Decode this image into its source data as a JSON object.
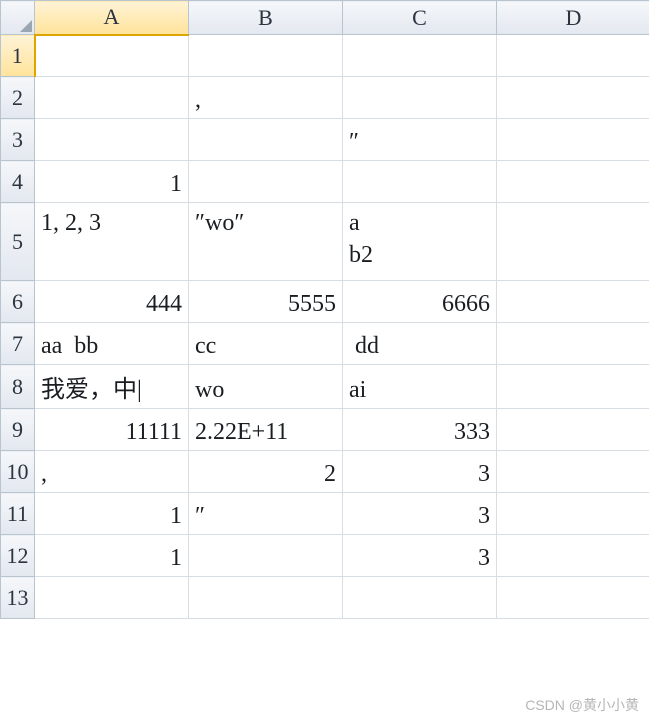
{
  "columns": [
    "A",
    "B",
    "C",
    "D"
  ],
  "rows": [
    "1",
    "2",
    "3",
    "4",
    "5",
    "6",
    "7",
    "8",
    "9",
    "10",
    "11",
    "12",
    "13"
  ],
  "selected_col": "A",
  "selected_row": "1",
  "cells": {
    "r1": {
      "A": "",
      "B": "",
      "C": "",
      "D": ""
    },
    "r2": {
      "A": "",
      "B": ",",
      "C": "",
      "D": ""
    },
    "r3": {
      "A": "",
      "B": "",
      "C": "″",
      "D": ""
    },
    "r4": {
      "A": "1",
      "B": "",
      "C": "",
      "D": ""
    },
    "r5": {
      "A": "1, 2, 3",
      "B": "″wo″",
      "C": "a\nb2",
      "D": ""
    },
    "r6": {
      "A": "444",
      "B": "5555",
      "C": "6666",
      "D": ""
    },
    "r7": {
      "A": "aa  bb",
      "B": "cc",
      "C": " dd",
      "D": ""
    },
    "r8": {
      "A": "我爱，中|",
      "B": "wo",
      "C": "ai",
      "D": ""
    },
    "r9": {
      "A": "11111",
      "B": "2.22E+11",
      "C": "333",
      "D": ""
    },
    "r10": {
      "A": ",",
      "B": "2",
      "C": "3",
      "D": ""
    },
    "r11": {
      "A": "1",
      "B": "″",
      "C": "3",
      "D": ""
    },
    "r12": {
      "A": "1",
      "B": "",
      "C": "3",
      "D": ""
    },
    "r13": {
      "A": "",
      "B": "",
      "C": "",
      "D": ""
    }
  },
  "cell_align": {
    "r4": {
      "A": "num"
    },
    "r5": {
      "A": "text",
      "B": "text",
      "C": "text"
    },
    "r6": {
      "A": "num",
      "B": "num",
      "C": "num"
    },
    "r7": {
      "A": "text",
      "B": "text",
      "C": "text"
    },
    "r8": {
      "A": "text",
      "B": "text",
      "C": "text"
    },
    "r9": {
      "A": "num",
      "B": "text",
      "C": "num"
    },
    "r10": {
      "A": "text",
      "B": "num",
      "C": "num"
    },
    "r11": {
      "A": "num",
      "B": "text",
      "C": "num"
    },
    "r12": {
      "A": "num",
      "C": "num"
    }
  },
  "tall_rows": [
    "r5"
  ],
  "watermark": "CSDN @黄小小黄"
}
